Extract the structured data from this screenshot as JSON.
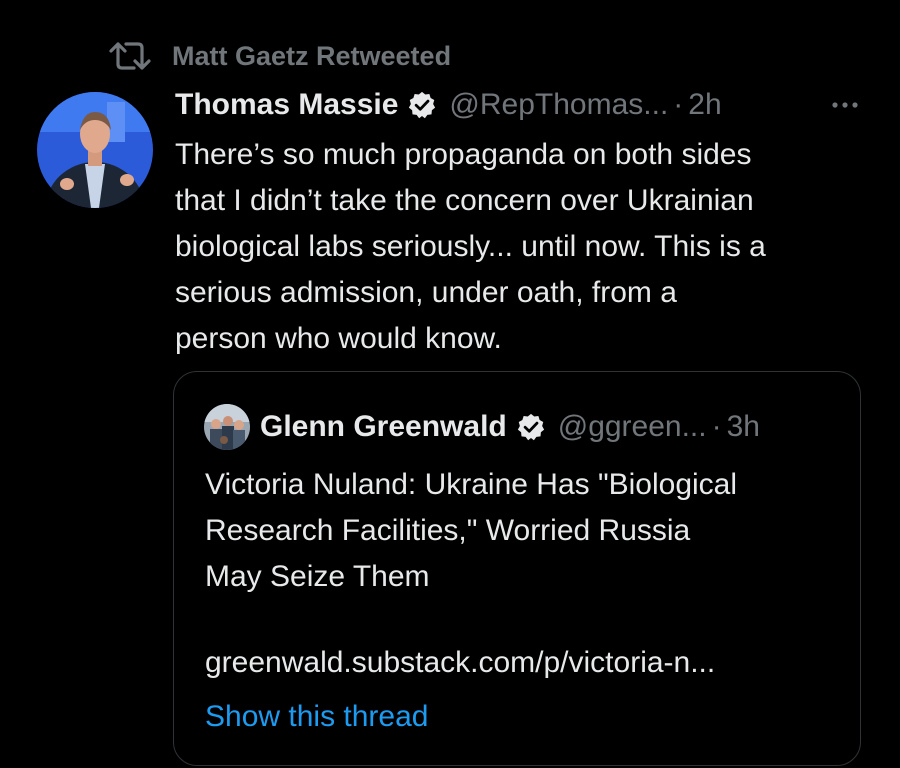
{
  "retweet": {
    "label": "Matt Gaetz Retweeted",
    "icon": "retweet-icon"
  },
  "tweet": {
    "author_name": "Thomas Massie",
    "verified": true,
    "handle": "@RepThomas...",
    "separator": "·",
    "time": "2h",
    "more_icon": "more-icon",
    "text_lines": [
      "There’s so much propaganda on both sides",
      "that I didn’t take the concern over Ukrainian",
      "biological labs seriously... until now. This is a",
      "serious admission, under oath, from a",
      "person who would know."
    ]
  },
  "quote": {
    "author_name": "Glenn Greenwald",
    "verified": true,
    "handle": "@ggreen...",
    "separator": "·",
    "time": "3h",
    "text_lines": [
      "Victoria Nuland: Ukraine Has \"Biological",
      "Research Facilities,\" Worried Russia",
      "May Seize Them"
    ],
    "link": "greenwald.substack.com/p/victoria-n...",
    "show_thread": "Show this thread"
  },
  "colors": {
    "background": "#000000",
    "text": "#e7e9ea",
    "muted": "#71767b",
    "accent": "#1d9bf0",
    "border": "#2f3336",
    "verified_badge": "#e7e9ea"
  }
}
